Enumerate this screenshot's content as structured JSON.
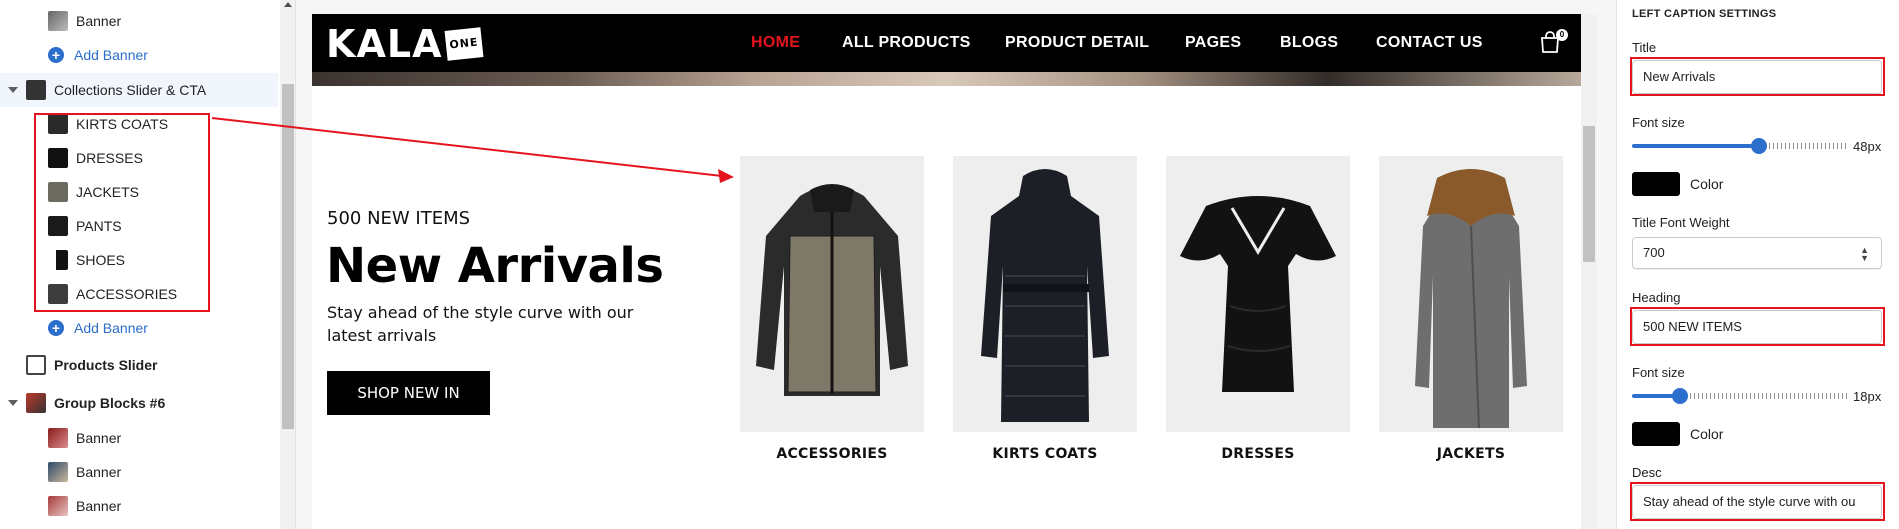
{
  "sidebar": {
    "rows": [
      {
        "label": "Banner"
      },
      {
        "label": "Add Banner"
      },
      {
        "label": "Collections Slider & CTA"
      },
      {
        "label": "KIRTS COATS"
      },
      {
        "label": "DRESSES"
      },
      {
        "label": "JACKETS"
      },
      {
        "label": "PANTS"
      },
      {
        "label": "SHOES"
      },
      {
        "label": "ACCESSORIES"
      },
      {
        "label": "Add Banner"
      },
      {
        "label": "Products Slider"
      },
      {
        "label": "Group Blocks #6"
      },
      {
        "label": "Banner"
      },
      {
        "label": "Banner"
      },
      {
        "label": "Banner"
      }
    ]
  },
  "store": {
    "logo_text": "KALA",
    "logo_badge": "ONE",
    "nav": [
      "HOME",
      "ALL PRODUCTS",
      "PRODUCT DETAIL",
      "PAGES",
      "BLOGS",
      "CONTACT US"
    ],
    "cart_count": "0",
    "accent_color": "#e4141e"
  },
  "caption": {
    "heading": "500 NEW ITEMS",
    "title": "New Arrivals",
    "desc": "Stay ahead of the style curve with our latest arrivals",
    "button": "SHOP NEW IN"
  },
  "products": [
    {
      "label": "ACCESSORIES"
    },
    {
      "label": "KIRTS COATS"
    },
    {
      "label": "DRESSES"
    },
    {
      "label": "JACKETS"
    }
  ],
  "settings": {
    "section_title": "LEFT CAPTION SETTINGS",
    "title_label": "Title",
    "title_value": "New Arrivals",
    "title_font_label": "Font size",
    "title_font_value": "48px",
    "title_font_fraction": 0.6,
    "color_label": "Color",
    "title_weight_label": "Title Font Weight",
    "title_weight_value": "700",
    "heading_label": "Heading",
    "heading_value": "500 NEW ITEMS",
    "heading_font_label": "Font size",
    "heading_font_value": "18px",
    "heading_font_fraction": 0.2,
    "color_label_2": "Color",
    "desc_label": "Desc",
    "desc_value": "Stay ahead of the style curve with ou"
  }
}
